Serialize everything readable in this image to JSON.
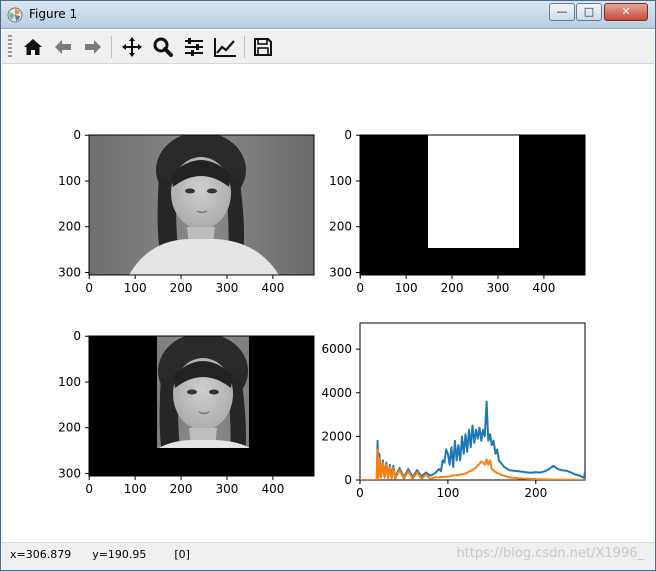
{
  "window": {
    "title": "Figure 1",
    "min_glyph": "—",
    "max_glyph": "□",
    "close_glyph": "✕"
  },
  "toolbar": {
    "buttons": [
      {
        "name": "home-icon"
      },
      {
        "name": "back-arrow-icon"
      },
      {
        "name": "forward-arrow-icon"
      },
      {
        "name": "pan-icon"
      },
      {
        "name": "zoom-icon"
      },
      {
        "name": "configure-subplots-icon"
      },
      {
        "name": "edit-axis-icon"
      },
      {
        "name": "save-icon"
      }
    ]
  },
  "status": {
    "text": "x=306.879      y=190.95        [0]",
    "watermark": "https://blog.csdn.net/X1996_"
  },
  "colors": {
    "series_blue": "#1f77b4",
    "series_orange": "#ff7f0e"
  },
  "chart_data": [
    {
      "type": "image",
      "content": "grayscale photo of a woman",
      "xticks": [
        "0",
        "100",
        "200",
        "300",
        "400"
      ],
      "yticks": [
        "0",
        "100",
        "200",
        "300"
      ]
    },
    {
      "type": "image",
      "content": "binary mask: white rectangle on black",
      "mask_rect": {
        "x0": 150,
        "x1": 350,
        "y0": 0,
        "y1": 250
      },
      "xticks": [
        "0",
        "100",
        "200",
        "300",
        "400"
      ],
      "yticks": [
        "0",
        "100",
        "200",
        "300"
      ]
    },
    {
      "type": "image",
      "content": "masked grayscale photo",
      "visible_rect": {
        "x0": 150,
        "x1": 350,
        "y0": 0,
        "y1": 250
      },
      "xticks": [
        "0",
        "100",
        "200",
        "300",
        "400"
      ],
      "yticks": [
        "0",
        "100",
        "200",
        "300"
      ]
    },
    {
      "type": "line",
      "xlim": [
        0,
        256
      ],
      "ylim": [
        0,
        7200
      ],
      "xticks": [
        "0",
        "100",
        "200"
      ],
      "yticks": [
        "0",
        "2000",
        "4000",
        "6000"
      ],
      "series": [
        {
          "color": "#1f77b4",
          "x": [
            0,
            19,
            20,
            21,
            22,
            24,
            26,
            28,
            30,
            32,
            34,
            36,
            38,
            40,
            45,
            50,
            55,
            60,
            65,
            70,
            75,
            80,
            85,
            90,
            92,
            94,
            96,
            98,
            100,
            102,
            104,
            106,
            108,
            110,
            112,
            114,
            116,
            118,
            120,
            122,
            124,
            126,
            128,
            130,
            132,
            134,
            136,
            138,
            140,
            142,
            144,
            146,
            148,
            150,
            152,
            154,
            156,
            158,
            160,
            162,
            164,
            166,
            168,
            170,
            175,
            180,
            185,
            190,
            195,
            200,
            205,
            210,
            215,
            220,
            225,
            230,
            235,
            240,
            245,
            250,
            255,
            256
          ],
          "y": [
            0,
            0,
            1800,
            200,
            1200,
            150,
            900,
            120,
            800,
            120,
            700,
            100,
            650,
            100,
            550,
            120,
            500,
            130,
            450,
            160,
            350,
            200,
            300,
            500,
            400,
            900,
            800,
            1400,
            1200,
            700,
            1500,
            600,
            1800,
            900,
            1600,
            900,
            2000,
            1200,
            2100,
            1300,
            2300,
            1500,
            2500,
            1700,
            2300,
            1900,
            2400,
            1800,
            2300,
            2000,
            3600,
            1800,
            2100,
            1600,
            1800,
            1200,
            1400,
            900,
            800,
            700,
            600,
            550,
            500,
            450,
            420,
            400,
            380,
            350,
            330,
            360,
            340,
            400,
            500,
            650,
            500,
            450,
            420,
            350,
            250,
            200,
            100,
            400
          ]
        },
        {
          "color": "#ff7f0e",
          "x": [
            0,
            19,
            20,
            21,
            22,
            24,
            26,
            28,
            30,
            32,
            34,
            36,
            38,
            40,
            45,
            50,
            55,
            60,
            65,
            70,
            75,
            80,
            85,
            90,
            95,
            100,
            105,
            110,
            115,
            120,
            125,
            130,
            135,
            138,
            140,
            142,
            144,
            146,
            148,
            150,
            155,
            160,
            165,
            170,
            180,
            190,
            200,
            220,
            240,
            256
          ],
          "y": [
            0,
            0,
            1400,
            100,
            1000,
            100,
            800,
            100,
            700,
            80,
            600,
            80,
            550,
            60,
            450,
            60,
            400,
            50,
            350,
            50,
            250,
            50,
            120,
            130,
            150,
            150,
            200,
            220,
            250,
            300,
            400,
            500,
            700,
            850,
            800,
            700,
            950,
            700,
            900,
            500,
            350,
            250,
            180,
            120,
            80,
            60,
            40,
            20,
            10,
            0
          ]
        }
      ]
    }
  ]
}
